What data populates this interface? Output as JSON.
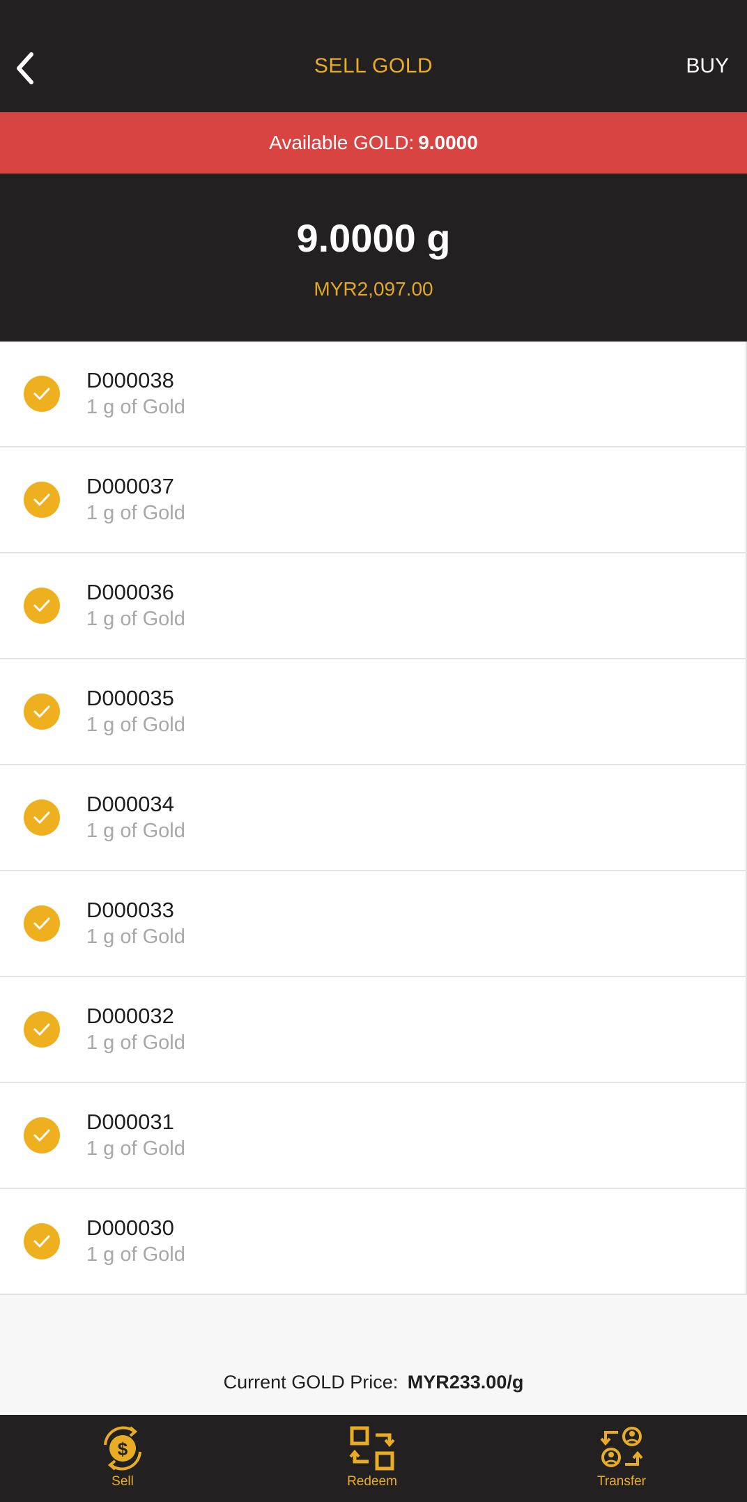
{
  "header": {
    "title": "SELL GOLD",
    "buy_label": "BUY"
  },
  "alert": {
    "prefix": "Available GOLD:",
    "value": "9.0000"
  },
  "summary": {
    "grams": "9.0000 g",
    "amount": "MYR2,097.00"
  },
  "items": [
    {
      "code": "D000038",
      "desc": "1 g of Gold"
    },
    {
      "code": "D000037",
      "desc": "1 g of Gold"
    },
    {
      "code": "D000036",
      "desc": "1 g of Gold"
    },
    {
      "code": "D000035",
      "desc": "1 g of Gold"
    },
    {
      "code": "D000034",
      "desc": "1 g of Gold"
    },
    {
      "code": "D000033",
      "desc": "1 g of Gold"
    },
    {
      "code": "D000032",
      "desc": "1 g of Gold"
    },
    {
      "code": "D000031",
      "desc": "1 g of Gold"
    },
    {
      "code": "D000030",
      "desc": "1 g of Gold"
    }
  ],
  "price": {
    "label": "Current GOLD Price:",
    "value": "MYR233.00/g"
  },
  "nav": {
    "sell": "Sell",
    "redeem": "Redeem",
    "transfer": "Transfer"
  },
  "icons": {
    "back": "chevron-left-icon",
    "check": "check-circle-icon",
    "sell": "dollar-coin-cycle-icon",
    "redeem": "exchange-squares-icon",
    "transfer": "user-transfer-icon"
  },
  "colors": {
    "accent": "#e8ad22",
    "alert": "#d84442",
    "dark": "#222021"
  }
}
